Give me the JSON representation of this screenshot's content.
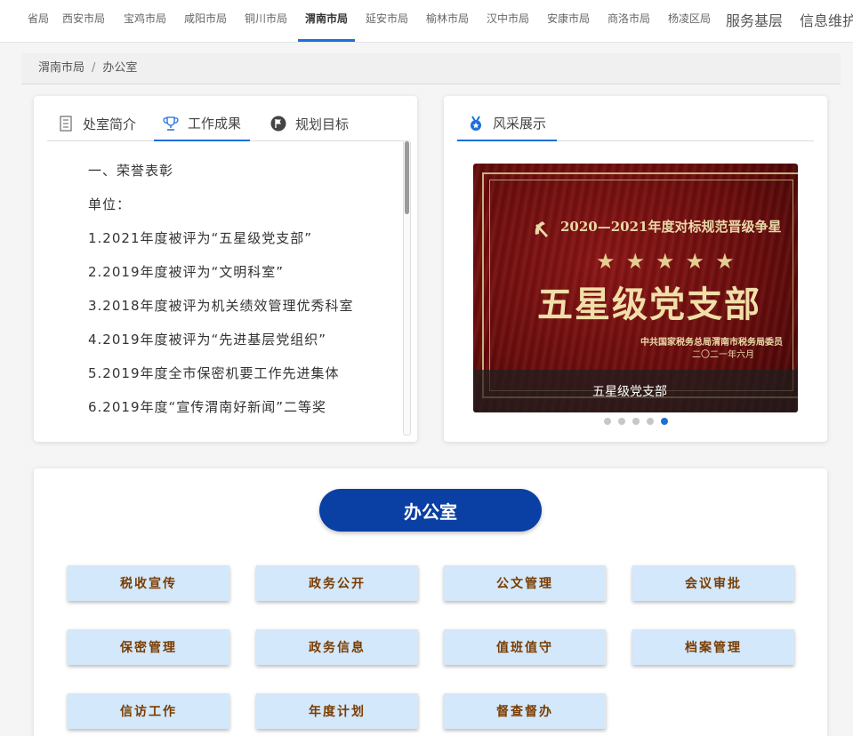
{
  "nav": {
    "items": [
      "省局",
      "西安市局",
      "宝鸡市局",
      "咸阳市局",
      "铜川市局",
      "渭南市局",
      "延安市局",
      "榆林市局",
      "汉中市局",
      "安康市局",
      "商洛市局",
      "杨凌区局"
    ],
    "active_index": 5,
    "right_items": [
      "服务基层",
      "信息维护"
    ]
  },
  "breadcrumb": {
    "root": "渭南市局",
    "separator": "/",
    "current": "办公室"
  },
  "left_panel": {
    "tabs": [
      {
        "label": "处室简介",
        "icon": "document-icon"
      },
      {
        "label": "工作成果",
        "icon": "trophy-icon"
      },
      {
        "label": "规划目标",
        "icon": "flag-icon"
      }
    ],
    "active_tab": 1,
    "lines": [
      "一、荣誉表彰",
      "单位：",
      "1.2021年度被评为“五星级党支部”",
      "2.2019年度被评为“文明科室”",
      "3.2018年度被评为机关绩效管理优秀科室",
      "4.2019年度被评为“先进基层党组织”",
      "5.2019年度全市保密机要工作先进集体",
      "6.2019年度“宣传渭南好新闻”二等奖"
    ]
  },
  "right_panel": {
    "tab_label": "风采展示",
    "tab_icon": "medal-icon",
    "slide": {
      "plaque_title": "2020—2021年度对标规范晋级争星",
      "plaque_stars": "★★★★★",
      "plaque_main": "五星级党支部",
      "plaque_org": "中共国家税务总局渭南市税务局委员",
      "plaque_date": "二〇二一年六月",
      "caption": "五星级党支部"
    },
    "dots_count": 5,
    "active_dot": 4
  },
  "office": {
    "title": "办公室",
    "buttons": [
      "税收宣传",
      "政务公开",
      "公文管理",
      "会议审批",
      "保密管理",
      "政务信息",
      "值班值守",
      "档案管理",
      "信访工作",
      "年度计划",
      "督查督办"
    ]
  },
  "colors": {
    "accent": "#1e6fd9",
    "pill": "#0a3fa3",
    "button_bg": "#d3e8fa",
    "button_text": "#7a3c00"
  }
}
